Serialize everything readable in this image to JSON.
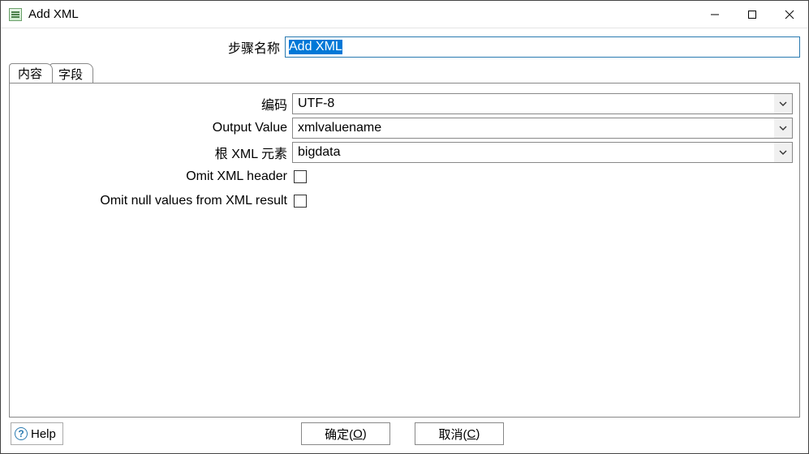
{
  "window": {
    "title": "Add XML"
  },
  "step_name": {
    "label": "步骤名称",
    "value": "Add XML"
  },
  "tabs": {
    "content": "内容",
    "fields": "字段"
  },
  "form": {
    "encoding_label": "编码",
    "encoding_value": "UTF-8",
    "output_value_label": "Output Value",
    "output_value_value": "xmlvaluename",
    "root_element_label": "根 XML 元素",
    "root_element_value": "bigdata",
    "omit_header_label": "Omit XML header",
    "omit_null_label": "Omit null values from XML result"
  },
  "buttons": {
    "help": "Help",
    "ok": "确定(",
    "ok_mn": "O",
    "ok_suffix": ")",
    "cancel": "取消(",
    "cancel_mn": "C",
    "cancel_suffix": ")"
  }
}
